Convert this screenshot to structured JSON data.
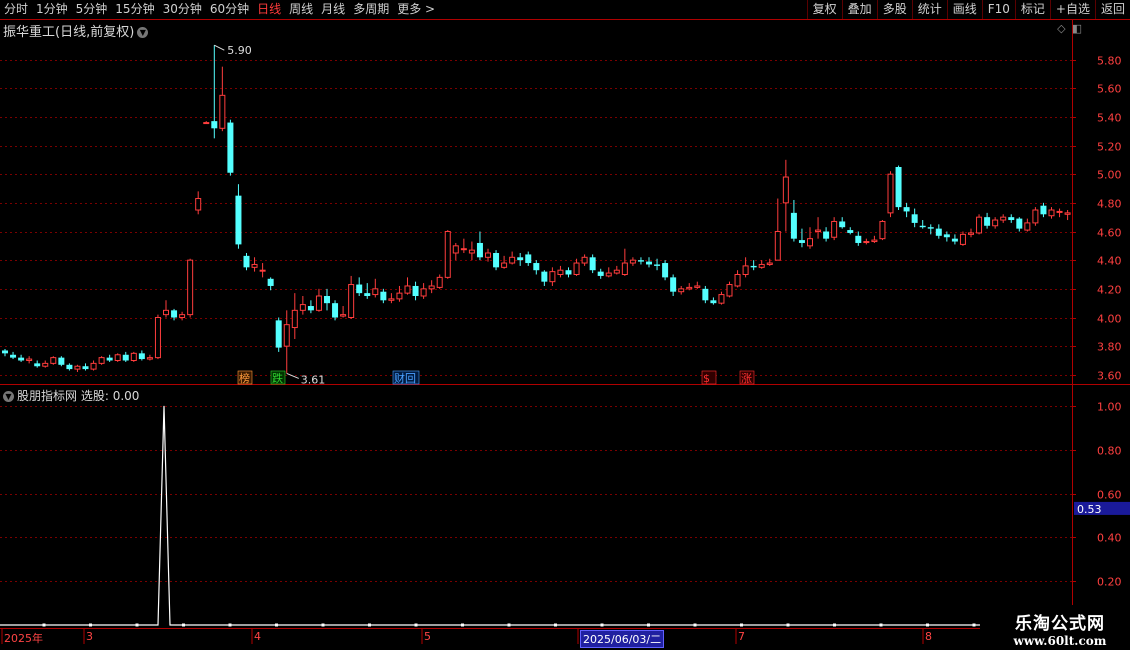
{
  "toolbar": {
    "periods": [
      "分时",
      "1分钟",
      "5分钟",
      "15分钟",
      "30分钟",
      "60分钟",
      "日线",
      "周线",
      "月线",
      "多周期",
      "更多 >"
    ],
    "active_period": "日线",
    "right_buttons": [
      "复权",
      "叠加",
      "多股",
      "统计",
      "画线",
      "F10",
      "标记",
      "+自选",
      "返回"
    ]
  },
  "main_panel": {
    "title": "振华重工(日线,前复权)",
    "price_axis": [
      "5.80",
      "5.60",
      "5.40",
      "5.20",
      "5.00",
      "4.80",
      "4.60",
      "4.40",
      "4.20",
      "4.00",
      "3.80",
      "3.60"
    ],
    "high_label": "5.90",
    "low_label": "3.61",
    "event_tags": [
      "榜",
      "跌",
      "财回",
      "$",
      "涨"
    ]
  },
  "sub_panel": {
    "title": "股朋指标网",
    "indicator_label": "选股:",
    "indicator_value": "0.00",
    "axis": [
      "1.00",
      "0.80",
      "0.60",
      "0.40",
      "0.20"
    ],
    "current_marker": "0.53"
  },
  "date_axis": {
    "labels": [
      "2025年",
      "3",
      "4",
      "5",
      "2025/06/03/二",
      "7",
      "8"
    ],
    "selected": "2025/06/03/二"
  },
  "watermark": {
    "line1": "乐淘公式网",
    "line2": "www.60lt.com"
  },
  "colors": {
    "up": "#ff3d3d",
    "down": "#54ffff",
    "grid": "#7a0000",
    "axis": "#b00000"
  },
  "chart_data": {
    "type": "candlestick",
    "ylim": [
      3.55,
      5.95
    ],
    "candles": [
      [
        3.77,
        3.75,
        3.78,
        3.73
      ],
      [
        3.74,
        3.72,
        3.76,
        3.71
      ],
      [
        3.72,
        3.7,
        3.74,
        3.69
      ],
      [
        3.7,
        3.71,
        3.73,
        3.68
      ],
      [
        3.68,
        3.66,
        3.7,
        3.65
      ],
      [
        3.66,
        3.68,
        3.7,
        3.65
      ],
      [
        3.68,
        3.72,
        3.73,
        3.67
      ],
      [
        3.72,
        3.67,
        3.73,
        3.66
      ],
      [
        3.67,
        3.64,
        3.68,
        3.63
      ],
      [
        3.64,
        3.66,
        3.67,
        3.62
      ],
      [
        3.66,
        3.64,
        3.68,
        3.63
      ],
      [
        3.64,
        3.68,
        3.7,
        3.63
      ],
      [
        3.68,
        3.72,
        3.73,
        3.67
      ],
      [
        3.72,
        3.7,
        3.74,
        3.69
      ],
      [
        3.7,
        3.74,
        3.75,
        3.69
      ],
      [
        3.74,
        3.7,
        3.76,
        3.69
      ],
      [
        3.7,
        3.75,
        3.76,
        3.69
      ],
      [
        3.75,
        3.71,
        3.77,
        3.7
      ],
      [
        3.71,
        3.72,
        3.74,
        3.7
      ],
      [
        3.72,
        4.0,
        4.02,
        3.71
      ],
      [
        4.02,
        4.05,
        4.12,
        4.0
      ],
      [
        4.05,
        4.0,
        4.06,
        3.98
      ],
      [
        4.0,
        4.02,
        4.04,
        3.98
      ],
      [
        4.02,
        4.4,
        4.41,
        4.0
      ],
      [
        4.75,
        4.83,
        4.88,
        4.72
      ],
      [
        5.36,
        5.36,
        5.37,
        5.36
      ],
      [
        5.37,
        5.32,
        5.9,
        5.25
      ],
      [
        5.32,
        5.55,
        5.75,
        5.3
      ],
      [
        5.36,
        5.01,
        5.38,
        4.99
      ],
      [
        4.85,
        4.51,
        4.93,
        4.48
      ],
      [
        4.43,
        4.35,
        4.45,
        4.33
      ],
      [
        4.35,
        4.37,
        4.42,
        4.32
      ],
      [
        4.33,
        4.33,
        4.38,
        4.28
      ],
      [
        4.27,
        4.22,
        4.28,
        4.19
      ],
      [
        3.98,
        3.79,
        4.0,
        3.76
      ],
      [
        3.8,
        3.95,
        4.05,
        3.61
      ],
      [
        3.93,
        4.05,
        4.17,
        3.85
      ],
      [
        4.05,
        4.09,
        4.15,
        4.02
      ],
      [
        4.08,
        4.05,
        4.12,
        4.03
      ],
      [
        4.05,
        4.15,
        4.2,
        4.04
      ],
      [
        4.15,
        4.1,
        4.2,
        4.05
      ],
      [
        4.1,
        4.0,
        4.12,
        3.98
      ],
      [
        4.01,
        4.02,
        4.08,
        4.0
      ],
      [
        4.0,
        4.23,
        4.29,
        3.99
      ],
      [
        4.23,
        4.17,
        4.28,
        4.15
      ],
      [
        4.17,
        4.15,
        4.24,
        4.13
      ],
      [
        4.16,
        4.2,
        4.27,
        4.14
      ],
      [
        4.18,
        4.12,
        4.2,
        4.1
      ],
      [
        4.12,
        4.13,
        4.17,
        4.1
      ],
      [
        4.13,
        4.17,
        4.22,
        4.11
      ],
      [
        4.17,
        4.22,
        4.28,
        4.16
      ],
      [
        4.22,
        4.15,
        4.25,
        4.12
      ],
      [
        4.15,
        4.2,
        4.24,
        4.13
      ],
      [
        4.2,
        4.22,
        4.26,
        4.17
      ],
      [
        4.21,
        4.28,
        4.3,
        4.2
      ],
      [
        4.28,
        4.6,
        4.61,
        4.27
      ],
      [
        4.45,
        4.5,
        4.52,
        4.4
      ],
      [
        4.48,
        4.48,
        4.55,
        4.45
      ],
      [
        4.45,
        4.47,
        4.53,
        4.4
      ],
      [
        4.52,
        4.42,
        4.6,
        4.4
      ],
      [
        4.42,
        4.45,
        4.48,
        4.39
      ],
      [
        4.45,
        4.35,
        4.47,
        4.33
      ],
      [
        4.35,
        4.38,
        4.43,
        4.34
      ],
      [
        4.38,
        4.42,
        4.46,
        4.37
      ],
      [
        4.42,
        4.4,
        4.45,
        4.36
      ],
      [
        4.44,
        4.38,
        4.46,
        4.36
      ],
      [
        4.38,
        4.33,
        4.4,
        4.3
      ],
      [
        4.32,
        4.25,
        4.33,
        4.22
      ],
      [
        4.25,
        4.32,
        4.35,
        4.22
      ],
      [
        4.3,
        4.33,
        4.36,
        4.28
      ],
      [
        4.33,
        4.3,
        4.35,
        4.28
      ],
      [
        4.3,
        4.38,
        4.41,
        4.29
      ],
      [
        4.38,
        4.42,
        4.44,
        4.36
      ],
      [
        4.42,
        4.33,
        4.44,
        4.31
      ],
      [
        4.32,
        4.29,
        4.34,
        4.27
      ],
      [
        4.29,
        4.31,
        4.35,
        4.28
      ],
      [
        4.31,
        4.33,
        4.36,
        4.3
      ],
      [
        4.3,
        4.38,
        4.48,
        4.29
      ],
      [
        4.38,
        4.4,
        4.42,
        4.36
      ],
      [
        4.4,
        4.39,
        4.42,
        4.37
      ],
      [
        4.39,
        4.37,
        4.42,
        4.35
      ],
      [
        4.37,
        4.36,
        4.41,
        4.33
      ],
      [
        4.38,
        4.28,
        4.4,
        4.26
      ],
      [
        4.28,
        4.18,
        4.3,
        4.15
      ],
      [
        4.18,
        4.2,
        4.22,
        4.16
      ],
      [
        4.2,
        4.21,
        4.24,
        4.19
      ],
      [
        4.21,
        4.22,
        4.25,
        4.2
      ],
      [
        4.2,
        4.12,
        4.22,
        4.1
      ],
      [
        4.12,
        4.1,
        4.14,
        4.09
      ],
      [
        4.1,
        4.16,
        4.18,
        4.09
      ],
      [
        4.15,
        4.23,
        4.25,
        4.14
      ],
      [
        4.22,
        4.3,
        4.33,
        4.21
      ],
      [
        4.3,
        4.36,
        4.42,
        4.28
      ],
      [
        4.36,
        4.35,
        4.4,
        4.33
      ],
      [
        4.35,
        4.37,
        4.4,
        4.34
      ],
      [
        4.37,
        4.38,
        4.41,
        4.36
      ],
      [
        4.4,
        4.6,
        4.83,
        4.4
      ],
      [
        4.8,
        4.98,
        5.1,
        4.6
      ],
      [
        4.73,
        4.55,
        4.82,
        4.53
      ],
      [
        4.54,
        4.52,
        4.62,
        4.49
      ],
      [
        4.5,
        4.55,
        4.63,
        4.48
      ],
      [
        4.6,
        4.61,
        4.7,
        4.55
      ],
      [
        4.6,
        4.55,
        4.63,
        4.53
      ],
      [
        4.56,
        4.67,
        4.7,
        4.54
      ],
      [
        4.67,
        4.63,
        4.7,
        4.62
      ],
      [
        4.61,
        4.59,
        4.63,
        4.58
      ],
      [
        4.57,
        4.52,
        4.6,
        4.5
      ],
      [
        4.53,
        4.53,
        4.55,
        4.51
      ],
      [
        4.53,
        4.54,
        4.57,
        4.52
      ],
      [
        4.55,
        4.67,
        4.68,
        4.54
      ],
      [
        4.73,
        5.0,
        5.02,
        4.7
      ],
      [
        5.05,
        4.77,
        5.06,
        4.75
      ],
      [
        4.77,
        4.74,
        4.8,
        4.7
      ],
      [
        4.72,
        4.66,
        4.76,
        4.63
      ],
      [
        4.64,
        4.63,
        4.68,
        4.62
      ],
      [
        4.63,
        4.62,
        4.65,
        4.58
      ],
      [
        4.62,
        4.57,
        4.65,
        4.55
      ],
      [
        4.58,
        4.56,
        4.6,
        4.53
      ],
      [
        4.55,
        4.53,
        4.58,
        4.51
      ],
      [
        4.51,
        4.58,
        4.6,
        4.5
      ],
      [
        4.58,
        4.59,
        4.62,
        4.56
      ],
      [
        4.59,
        4.7,
        4.72,
        4.58
      ],
      [
        4.7,
        4.64,
        4.73,
        4.62
      ],
      [
        4.64,
        4.68,
        4.7,
        4.62
      ],
      [
        4.68,
        4.7,
        4.72,
        4.66
      ],
      [
        4.7,
        4.68,
        4.72,
        4.66
      ],
      [
        4.69,
        4.62,
        4.7,
        4.6
      ],
      [
        4.61,
        4.66,
        4.69,
        4.6
      ],
      [
        4.66,
        4.75,
        4.77,
        4.64
      ],
      [
        4.78,
        4.72,
        4.8,
        4.7
      ],
      [
        4.71,
        4.75,
        4.77,
        4.69
      ],
      [
        4.74,
        4.74,
        4.76,
        4.7
      ],
      [
        4.72,
        4.73,
        4.75,
        4.68
      ]
    ],
    "indicator_ylim": [
      0,
      1.05
    ],
    "indicator_spike": {
      "index": 20,
      "value": 1.0
    }
  }
}
